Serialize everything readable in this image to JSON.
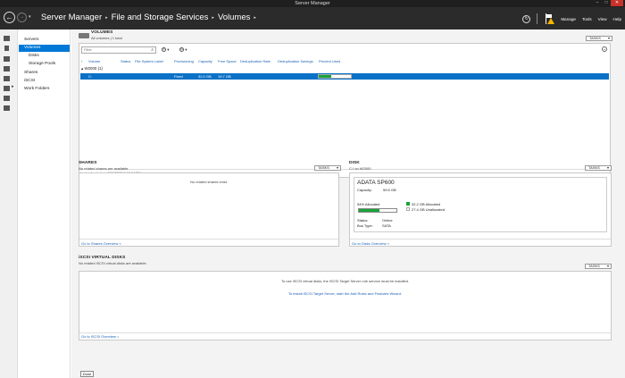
{
  "window": {
    "title": "Server Manager",
    "controls": [
      "–",
      "□",
      "✕"
    ]
  },
  "header": {
    "breadcrumb": [
      "Server Manager",
      "File and Storage Services",
      "Volumes"
    ],
    "menu": [
      "Manage",
      "Tools",
      "View",
      "Help"
    ]
  },
  "nav": {
    "items": [
      {
        "label": "Servers",
        "sub": false,
        "selected": false
      },
      {
        "label": "Volumes",
        "sub": false,
        "selected": true
      },
      {
        "label": "Disks",
        "sub": true,
        "selected": false
      },
      {
        "label": "Storage Pools",
        "sub": true,
        "selected": false
      },
      {
        "label": "Shares",
        "sub": false,
        "selected": false
      },
      {
        "label": "iSCSI",
        "sub": false,
        "selected": false
      },
      {
        "label": "Work Folders",
        "sub": false,
        "selected": false
      }
    ]
  },
  "volumes": {
    "title": "VOLUMES",
    "subtitle": "All volumes | 1 total",
    "tasks": "TASKS",
    "filter_placeholder": "Filter",
    "columns": [
      "Volume",
      "Status",
      "File System Label",
      "Provisioning",
      "Capacity",
      "Free Space",
      "Deduplication Rate",
      "Deduplication Savings",
      "Percent Used"
    ],
    "group": "W2000 (1)",
    "row": {
      "volume": "C:",
      "provisioning": "Fixed",
      "capacity": "32.0 GB",
      "free": "19.7 GB",
      "percent_used": 0.38
    },
    "refreshed": "Last refreshed on 8/11/2015 9:49:04 PM"
  },
  "shares": {
    "title": "SHARES",
    "subtitle": "No related shares are available.",
    "tasks": "TASKS",
    "empty": "No related shares exist.",
    "link": "Go to Shares Overview >"
  },
  "disk": {
    "title": "DISK",
    "subtitle": "C:\\ on W2000",
    "tasks": "TASKS",
    "name": "ADATA SP600",
    "capacity_label": "Capacity:",
    "capacity": "59.6 GB",
    "allocated_pct_text": "54% Allocated",
    "allocated_fraction": 0.54,
    "allocated_legend": "32.2 GB Allocated",
    "unallocated_legend": "27.4 GB Unallocated",
    "status_label": "Status:",
    "status": "Online",
    "bustype_label": "Bus Type:",
    "bustype": "SATA",
    "link": "Go to Disks Overview >",
    "colors": {
      "allocated": "#1aa33a",
      "unallocated": "#ffffff"
    }
  },
  "iscsi": {
    "title": "iSCSI VIRTUAL DISKS",
    "subtitle": "No related iSCSI virtual disks are available.",
    "tasks": "TASKS",
    "msg": "To use iSCSI virtual disks, the iSCSI Target Server role service must be installed.",
    "install_link": "To install iSCSI Target Server, start the Add Roles and Features Wizard.",
    "link": "Go to iSCSI Overview >"
  },
  "footer": {
    "done": "Done"
  },
  "colors": {
    "accent": "#0078d7",
    "selection": "#0b71c7",
    "header_bg": "#2b2b2b",
    "warning": "#f4b400"
  }
}
